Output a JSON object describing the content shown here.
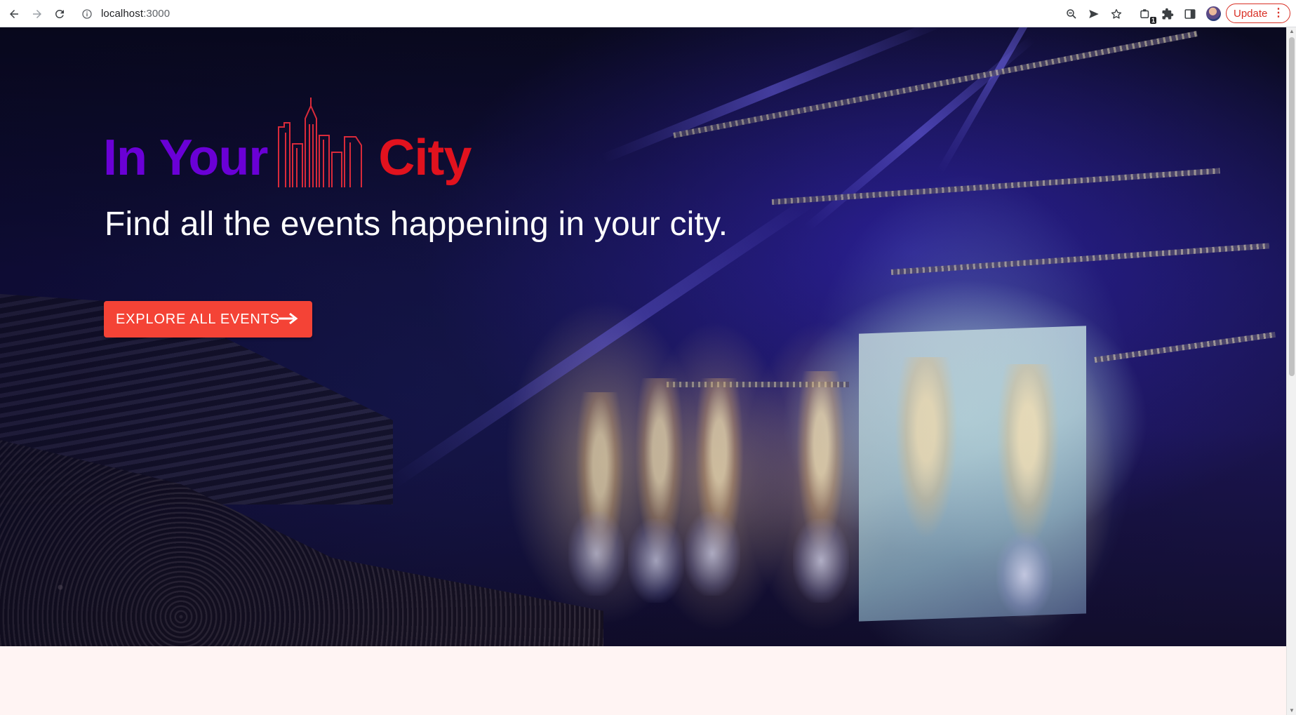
{
  "browser": {
    "url_host": "localhost",
    "url_port": ":3000",
    "update_label": "Update",
    "extension_badge": "1",
    "icons": {
      "back": "arrow-left-icon",
      "forward": "arrow-right-icon",
      "reload": "reload-icon",
      "site_info": "info-icon",
      "zoom": "zoom-icon",
      "send": "send-icon",
      "bookmark": "star-icon",
      "extension": "extension-icon",
      "puzzle": "puzzle-icon",
      "sidepanel": "side-panel-icon",
      "menu": "kebab-menu-icon"
    },
    "update_color": "#d93025"
  },
  "hero": {
    "brand_left": "In Your",
    "brand_right": "City",
    "brand_left_color": "#6a00d6",
    "brand_right_color": "#e1121e",
    "tagline": "Find all the events happening in your city.",
    "cta_label": "EXPLORE ALL EVENTS",
    "cta_color": "#f44336",
    "logo_icon": "city-skyline-icon",
    "cta_icon": "long-arrow-right-icon"
  },
  "page": {
    "below_fold_color": "#fff4f3"
  }
}
